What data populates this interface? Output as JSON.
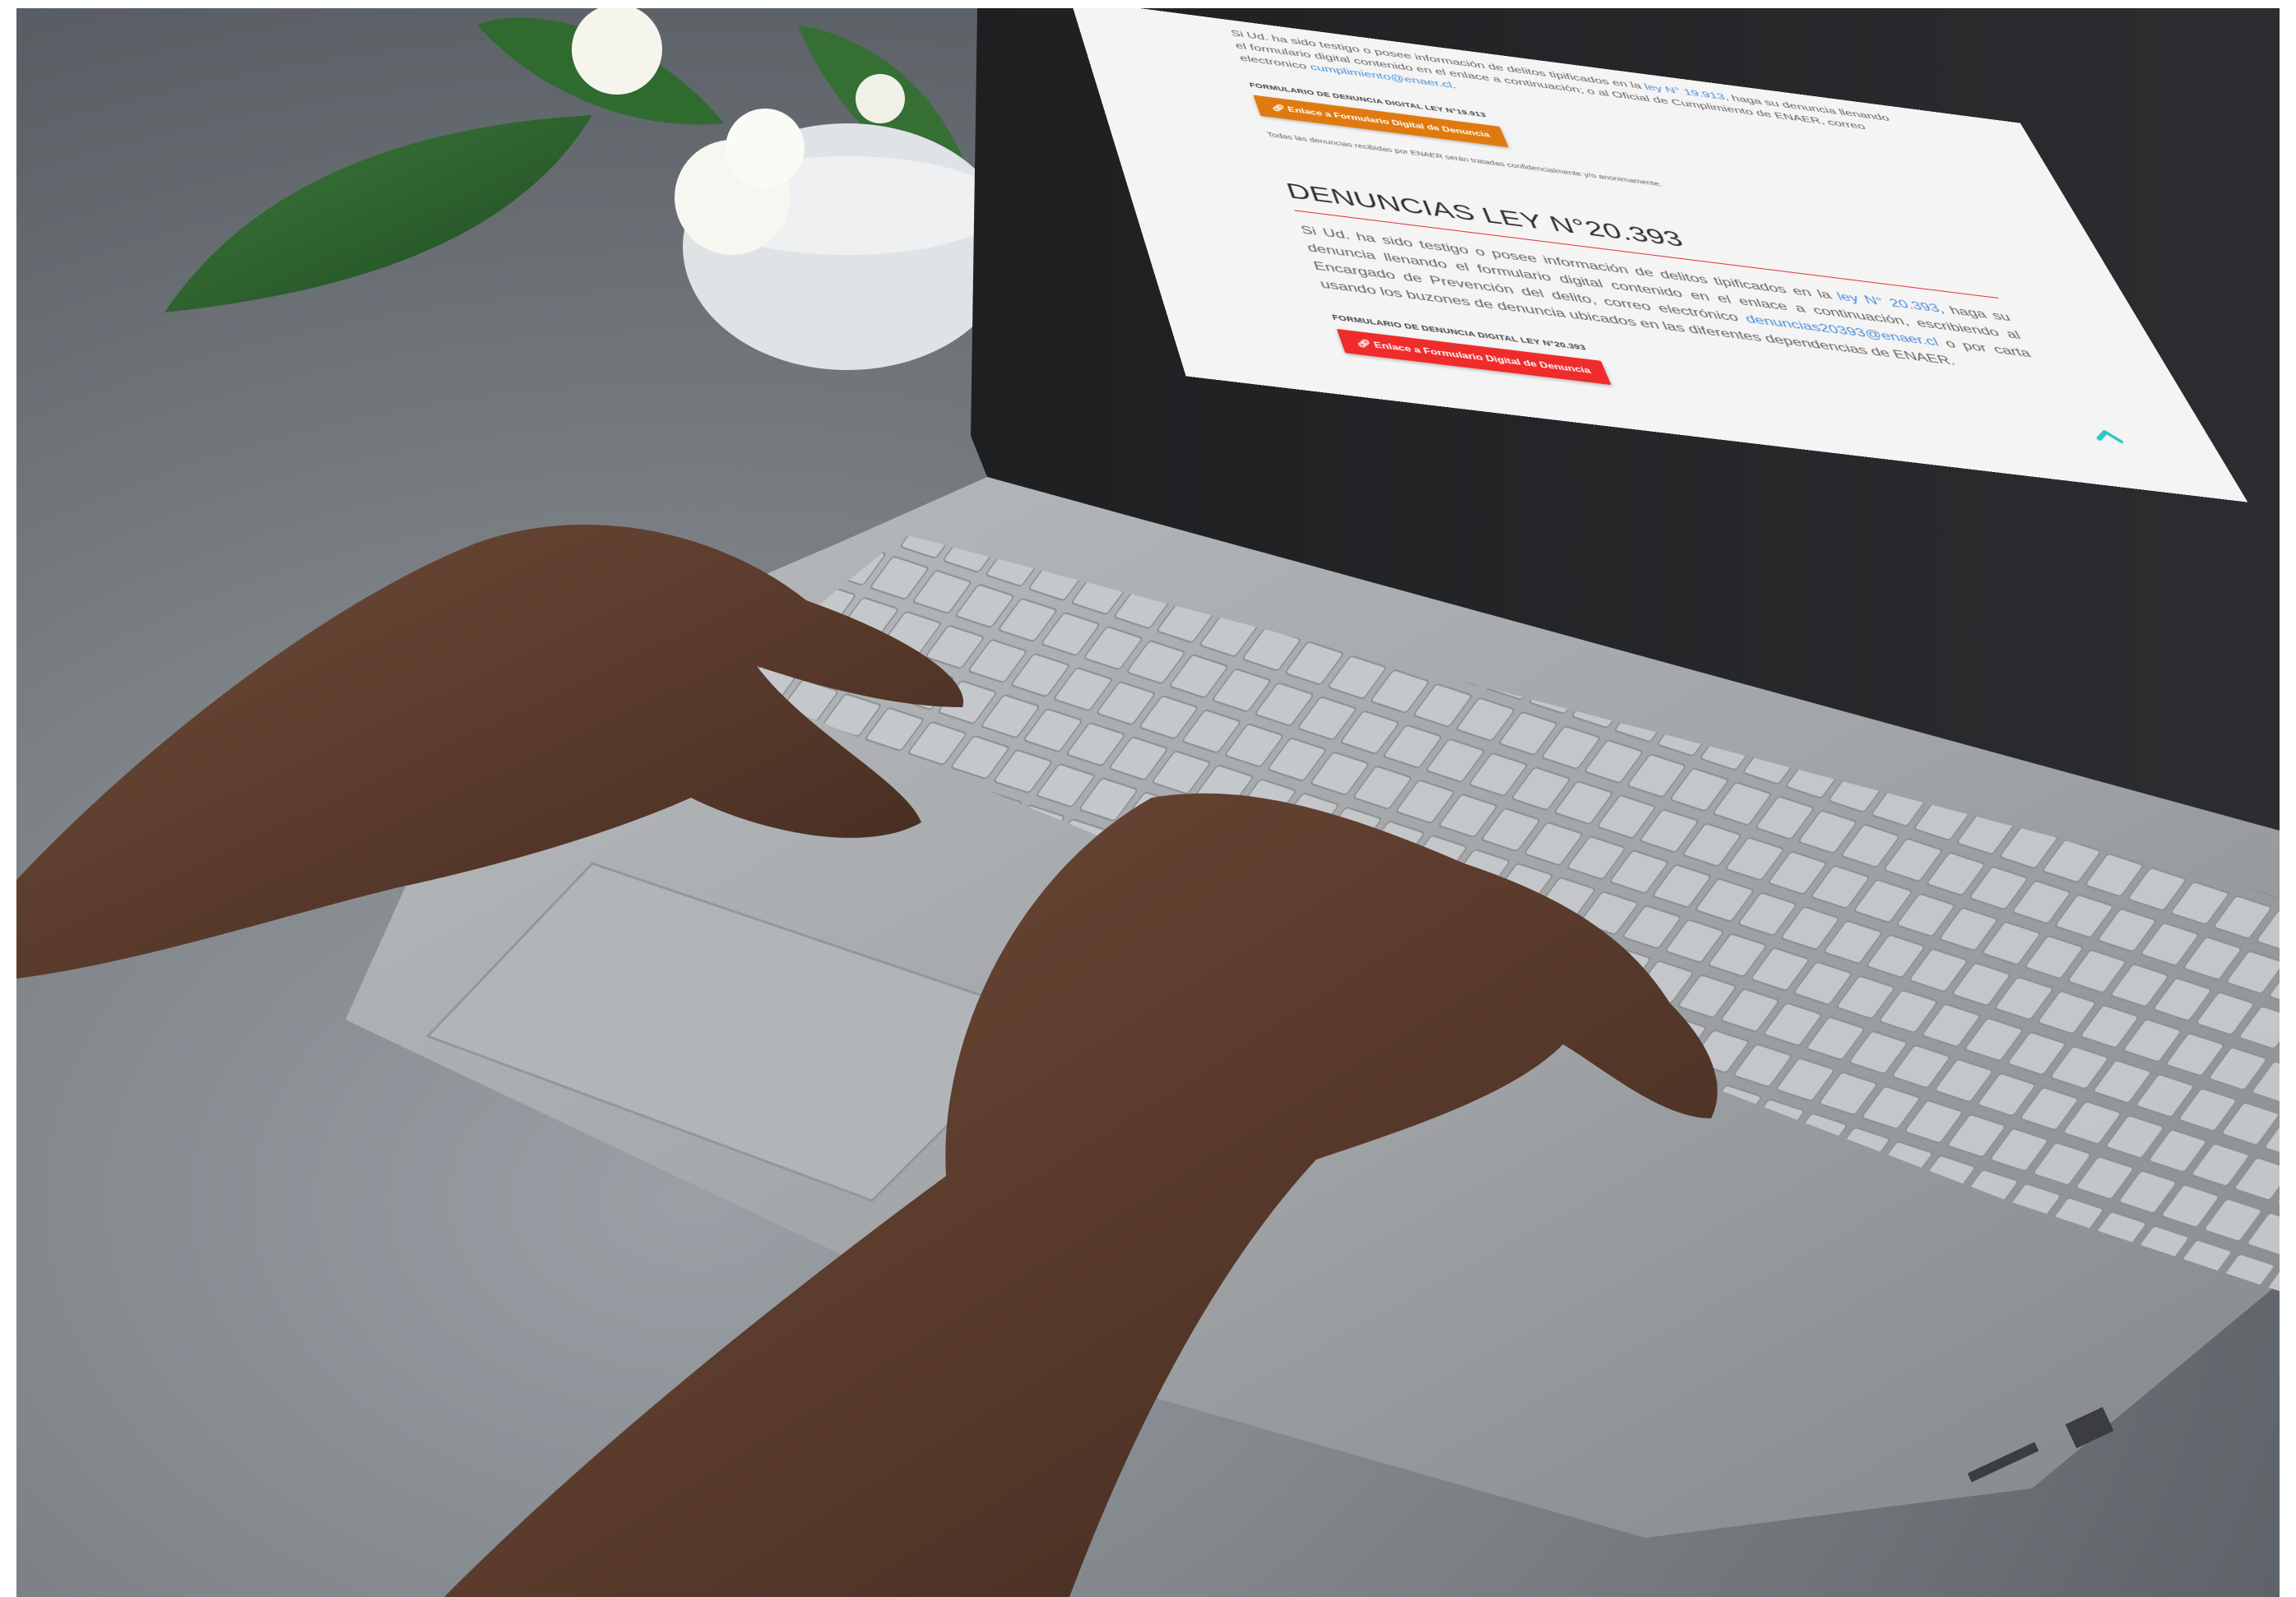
{
  "screen": {
    "intro_prefix": "Si Ud. ha sido testigo o posee información de delitos tipificados en la",
    "intro_law_link": "ley N° 19.913",
    "intro_middle": ", haga su denuncia llenando el formulario digital contenido en el enlace a continuación; o al Oficial de Cumplimiento de ENAER, correo electronico",
    "intro_email": "cumplimiento@enaer.cl",
    "intro_suffix": ".",
    "form_label_19913": "FORMULARIO DE DENUNCIA DIGITAL LEY N°19.913",
    "button_19913": "Enlace a Formulario Digital de Denuncia",
    "confidential_note": "Todas las denuncias recibidas por ENAER serán tratadas confidencialmente y/o anonimamente.",
    "section_heading": "DENUNCIAS LEY N°20.393",
    "body_prefix": "Si Ud. ha sido testigo o posee información de delitos tipificados en la",
    "body_law_link": "ley N° 20.393",
    "body_middle": ", haga su denuncia llenando el formulario digital contenido en el enlace a continuación, escribiendo al Encargado de Prevención del delito, correo electrónico",
    "body_email": "denuncias20393@enaer.cl",
    "body_suffix": " o por carta usando los buzones de denuncia ubicados en las diferentes dependencias de ENAER.",
    "form_label_20393": "FORMULARIO DE DENUNCIA DIGITAL LEY N°20.393",
    "button_20393": "Enlace a Formulario Digital de Denuncia",
    "scroll_top_icon": "chevron-up-icon"
  },
  "colors": {
    "orange_button": "#e07a10",
    "red_button": "#ef2b2b",
    "heading_rule": "#e23b3b",
    "link": "#4a90d9",
    "scroll_top": "#2ec4c4"
  }
}
